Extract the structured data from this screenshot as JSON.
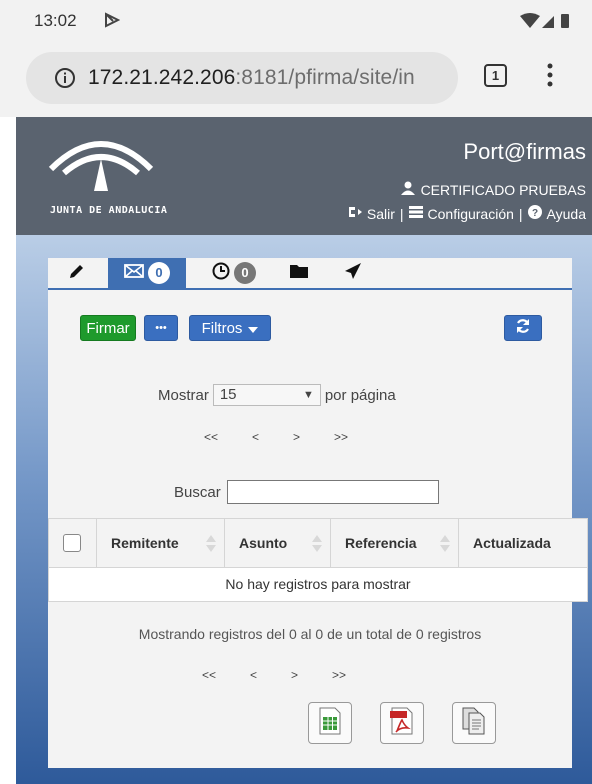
{
  "status_bar": {
    "time": "13:02"
  },
  "browser": {
    "url_host": "172.21.242.206",
    "url_rest": ":8181/pfirma/site/in",
    "tab_count": "1"
  },
  "header": {
    "logo_text": "JUNTA DE ANDALUCIA",
    "app_title": "Port@firmas",
    "user": "CERTIFICADO PRUEBAS",
    "links": {
      "salir": "Salir",
      "sep1": "|",
      "config": "Configuración",
      "sep2": "|",
      "ayuda": "Ayuda"
    }
  },
  "tabs": {
    "inbox_count": "0",
    "pending_count": "0"
  },
  "toolbar": {
    "firmar": "Firmar",
    "more": "•••",
    "filtros": "Filtros"
  },
  "pagination": {
    "mostrar_label": "Mostrar",
    "page_size": "15",
    "por_pagina": "por página",
    "first": "<<",
    "prev": "<",
    "next": ">",
    "last": ">>"
  },
  "search": {
    "label": "Buscar",
    "value": ""
  },
  "table": {
    "columns": [
      "Remitente",
      "Asunto",
      "Referencia",
      "Actualizada"
    ],
    "empty_message": "No hay registros para mostrar"
  },
  "info": "Mostrando registros del 0 al 0 de un total de 0 registros",
  "colors": {
    "header_bg": "#5a636f",
    "accent_blue": "#3f6fb2",
    "green_button": "#1e9a2c"
  }
}
